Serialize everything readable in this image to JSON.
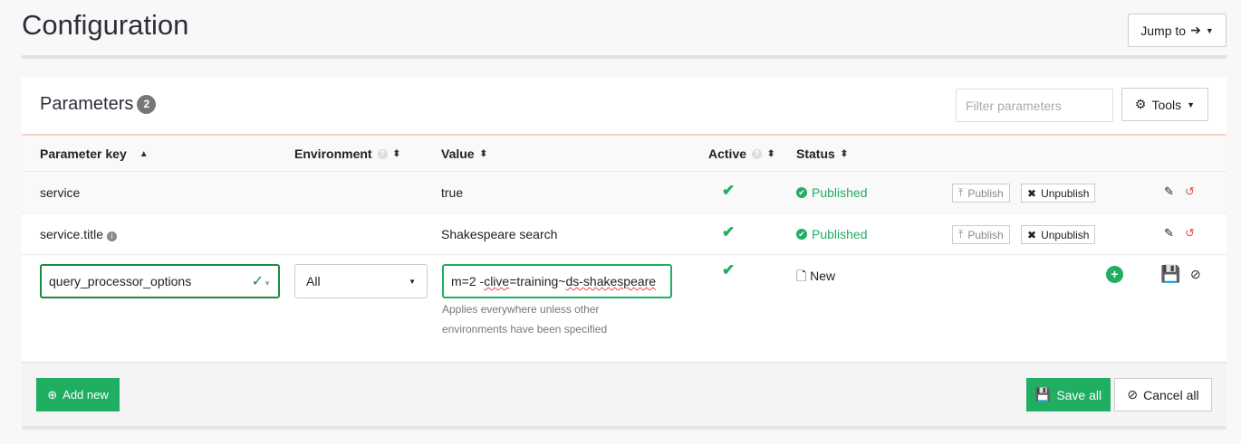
{
  "page": {
    "title": "Configuration",
    "jump_to": "Jump to"
  },
  "panel": {
    "title": "Parameters",
    "count": "2",
    "filter_placeholder": "Filter parameters",
    "tools": "Tools"
  },
  "columns": {
    "key": "Parameter key",
    "environment": "Environment",
    "value": "Value",
    "active": "Active",
    "status": "Status"
  },
  "rows": [
    {
      "key": "service",
      "value": "true",
      "status": "Published",
      "publish": "Publish",
      "unpublish": "Unpublish"
    },
    {
      "key": "service.title",
      "value": "Shakespeare search",
      "status": "Published",
      "publish": "Publish",
      "unpublish": "Unpublish"
    }
  ],
  "new_row": {
    "key": "query_processor_options",
    "environment": "All",
    "value_prefix": "m=2 -",
    "value_w1": "clive",
    "value_mid": "=training~",
    "value_w2": "ds-shakespeare",
    "hint": "Applies everywhere unless other environments have been specified",
    "status": "New"
  },
  "footer": {
    "add_new": "Add new",
    "save_all": "Save all",
    "cancel_all": "Cancel all"
  },
  "colors": {
    "green": "#1fae62",
    "red": "#e55353"
  }
}
